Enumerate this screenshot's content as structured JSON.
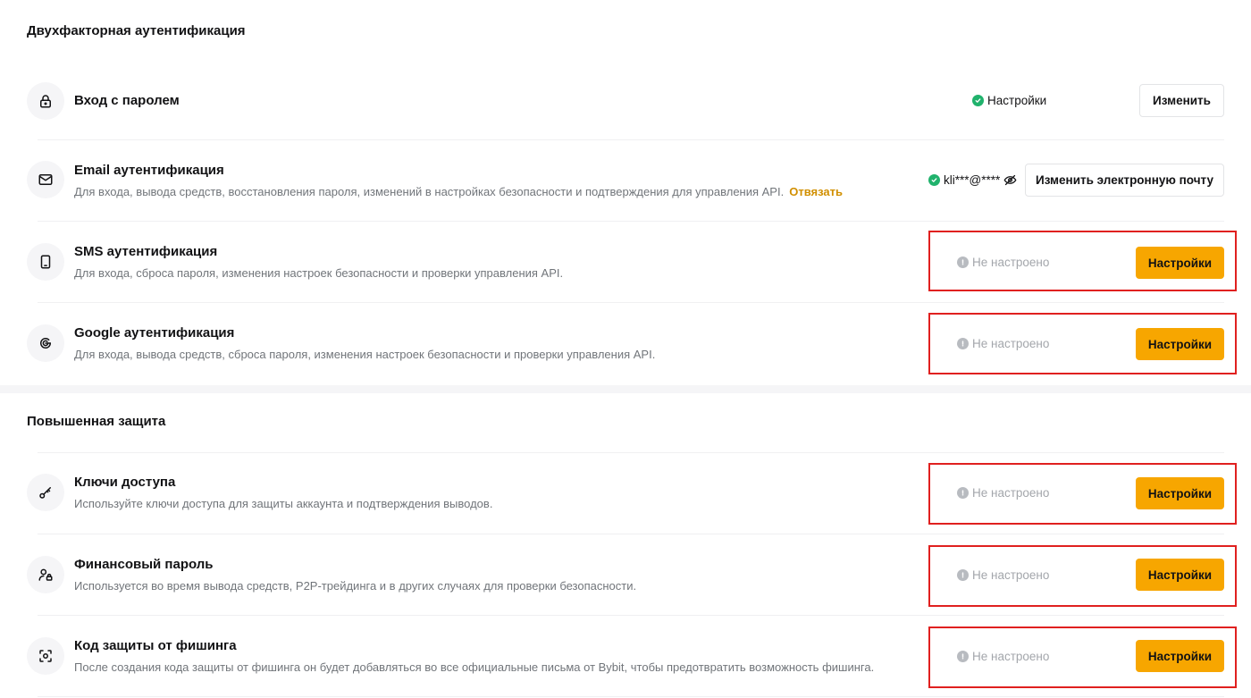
{
  "sections": {
    "two_factor": {
      "title": "Двухфакторная аутентификация"
    },
    "advanced": {
      "title": "Повышенная защита"
    }
  },
  "rows": {
    "password": {
      "title": "Вход с паролем",
      "status": "Настройки",
      "button": "Изменить"
    },
    "email": {
      "title": "Email аутентификация",
      "description": "Для входа, вывода средств, восстановления пароля, изменений в настройках безопасности и подтверждения для управления API.",
      "link": "Отвязать",
      "status": "kli***@****",
      "button": "Изменить электронную почту"
    },
    "sms": {
      "title": "SMS аутентификация",
      "description": "Для входа, сброса пароля, изменения настроек безопасности и проверки управления API.",
      "status": "Не настроено",
      "button": "Настройки"
    },
    "google": {
      "title": "Google аутентификация",
      "description": "Для входа, вывода средств, сброса пароля, изменения настроек безопасности и проверки управления API.",
      "status": "Не настроено",
      "button": "Настройки"
    },
    "passkeys": {
      "title": "Ключи доступа",
      "description": "Используйте ключи доступа для защиты аккаунта и подтверждения выводов.",
      "status": "Не настроено",
      "button": "Настройки"
    },
    "fund_password": {
      "title": "Финансовый пароль",
      "description": "Используется во время вывода средств, P2P-трейдинга и в других случаях для проверки безопасности.",
      "status": "Не настроено",
      "button": "Настройки"
    },
    "anti_phishing": {
      "title": "Код защиты от фишинга",
      "description": "После создания кода защиты от фишинга он будет добавляться во все официальные письма от Bybit, чтобы предотвратить возможность фишинга.",
      "status": "Не настроено",
      "button": "Настройки"
    }
  },
  "colors": {
    "accent": "#f7a600",
    "success": "#20b26c",
    "link": "#d18f00",
    "highlight": "#e0201f",
    "muted": "#a3a6ab"
  }
}
